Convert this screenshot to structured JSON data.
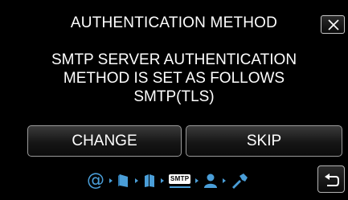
{
  "dialog": {
    "title": "AUTHENTICATION METHOD",
    "message_lines": [
      "SMTP SERVER AUTHENTICATION",
      "METHOD IS SET AS FOLLOWS",
      "SMTP(TLS)"
    ],
    "close_icon": "close-icon"
  },
  "actions": {
    "change_label": "CHANGE",
    "skip_label": "SKIP"
  },
  "progress": {
    "steps": [
      {
        "icon": "at-sign-icon",
        "glyph": "@"
      },
      {
        "icon": "mail-server-icon"
      },
      {
        "icon": "book-icon"
      },
      {
        "icon": "smtp-icon",
        "label": "SMTP",
        "active": true
      },
      {
        "icon": "user-icon"
      },
      {
        "icon": "settings-tool-icon"
      }
    ],
    "accent_color": "#4a9ed8"
  },
  "navigation": {
    "back_icon": "return-arrow-icon"
  }
}
